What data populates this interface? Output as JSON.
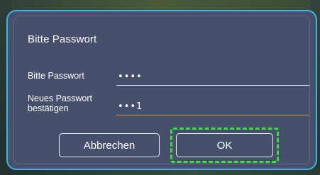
{
  "dialog": {
    "title": "Bitte Passwort",
    "fields": [
      {
        "label": "Bitte Passwort",
        "value": "••••"
      },
      {
        "label": "Neues Passwort bestätigen",
        "value": "•••1"
      }
    ],
    "buttons": {
      "cancel": "Abbrechen",
      "ok": "OK"
    }
  },
  "colors": {
    "dialog_background": "#46506d",
    "dialog_border": "#36b9e3",
    "focus_outline": "#3de03d",
    "active_underline": "#c79a3a"
  }
}
